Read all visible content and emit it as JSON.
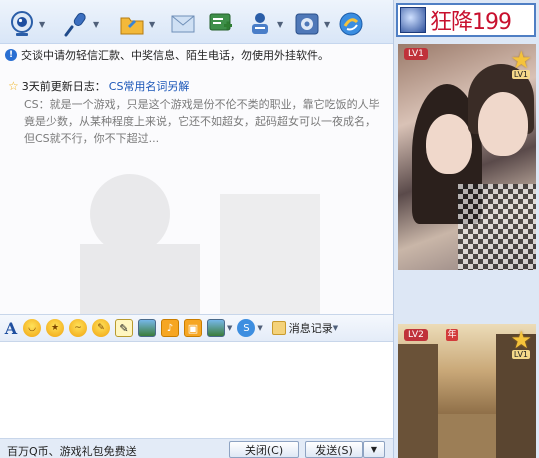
{
  "toolbar": {
    "items": [
      {
        "name": "video-call",
        "icon": "webcam-icon",
        "has_dropdown": true
      },
      {
        "name": "voice-call",
        "icon": "microphone-icon",
        "has_dropdown": true
      },
      {
        "name": "send-file",
        "icon": "folder-icon",
        "has_dropdown": true
      },
      {
        "name": "send-sms",
        "icon": "envelope-icon",
        "has_dropdown": false
      },
      {
        "name": "create-discussion",
        "icon": "add-member-icon",
        "has_dropdown": false
      },
      {
        "name": "apps",
        "icon": "person-apps-icon",
        "has_dropdown": true
      },
      {
        "name": "settings",
        "icon": "gear-icon",
        "has_dropdown": true
      },
      {
        "name": "remote-assist",
        "icon": "remote-icon",
        "has_dropdown": false
      }
    ]
  },
  "chat": {
    "warning": "交谈中请勿轻信汇款、中奖信息、陌生电话，勿使用外挂软件。",
    "log_prefix": "3天前更新日志：",
    "log_link": "CS常用名词另解",
    "log_body": "CS：就是一个游戏，只是这个游戏是份不伦不类的职业，靠它吃饭的人毕竟是少数，从某种程度上来说，它还不如超女，起码超女可以一夜成名，但CS就不行，你不下超过..."
  },
  "format_bar": {
    "font_glyph": "A",
    "message_record": "消息记录"
  },
  "input": {
    "value": ""
  },
  "bottom": {
    "promo": "百万Q币、游戏礼包免费送",
    "close_label": "关闭(C)",
    "send_label": "发送(S)",
    "send_dropdown": "▼"
  },
  "right_panel": {
    "banner_text": "狂降199",
    "avatar1_level": "LV1",
    "avatar1_star_level": "LV1",
    "avatar2_level": "LV2",
    "avatar2_year_badge": "年",
    "avatar2_star_level": "LV1"
  },
  "colors": {
    "toolbar_bg": "#dde8f7",
    "link": "#1a56b8",
    "banner_red": "#c8102e",
    "banner_border": "#4f7fc4"
  }
}
